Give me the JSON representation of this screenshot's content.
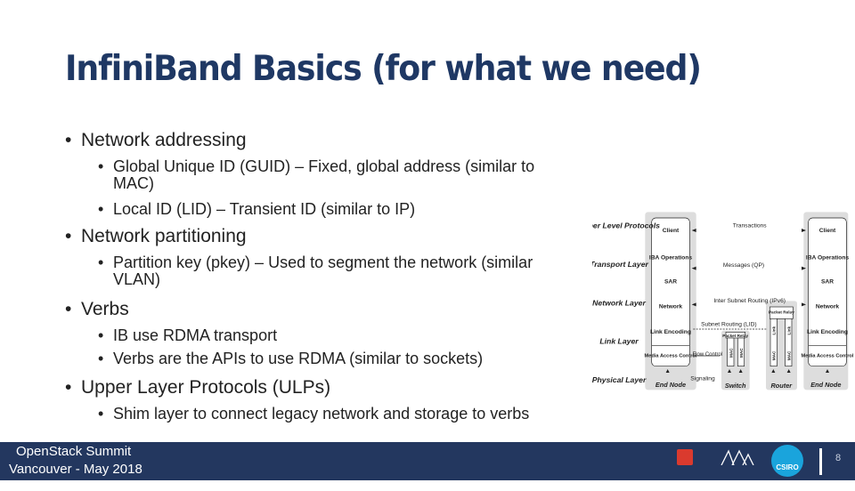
{
  "title": "InfiniBand Basics (for what we need)",
  "bullets": [
    {
      "text": "Network addressing",
      "sub": [
        [
          "Global Unique ID (GUID) – Fixed, global address (similar to",
          "MAC)"
        ],
        [
          "Local ID (LID) – Transient ID (similar to IP)"
        ]
      ]
    },
    {
      "text": "Network partitioning",
      "sub": [
        [
          "Partition key (pkey) – Used to segment the network (similar",
          "VLAN)"
        ]
      ]
    },
    {
      "text": "Verbs",
      "sub": [
        [
          "IB use RDMA transport"
        ],
        [
          "Verbs are the APIs to use RDMA (similar to sockets)"
        ]
      ]
    },
    {
      "text": "Upper Layer Protocols (ULPs)",
      "sub": [
        [
          "Shim layer to connect legacy network and storage to verbs"
        ]
      ]
    }
  ],
  "diagram": {
    "layers": [
      "Upper Level Protocols",
      "Transport Layer",
      "Network Layer",
      "Link Layer",
      "Physical Layer"
    ],
    "node_blocks": [
      "Client",
      "IBA Operations",
      "SAR",
      "Network",
      "Link Encoding",
      "Media Access Control"
    ],
    "middle": [
      "Transactions",
      "Messages (QP)",
      "Inter Subnet Routing (IPv6)",
      "Subnet Routing (LID)",
      "Flow Control",
      "Signaling"
    ],
    "relay": "Packet Relay",
    "mac": "MAC",
    "link": "Link",
    "nodes": [
      "End Node",
      "Switch",
      "Router",
      "End Node"
    ]
  },
  "footer": {
    "line1": "OpenStack Summit",
    "line2": "Vancouver - May 2018",
    "logos": [
      "openstack",
      "Mellanox",
      "CSIRO"
    ],
    "page": "8",
    "colors": {
      "footer_bg": "#23375f",
      "title": "#1f3864"
    }
  }
}
